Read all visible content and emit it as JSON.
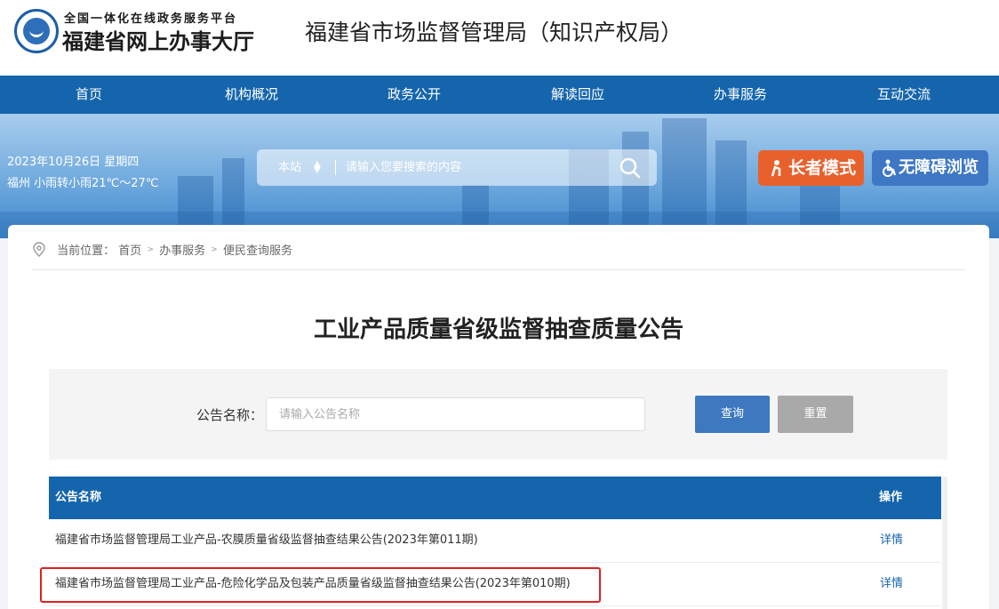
{
  "header": {
    "logo_line1": "全国一体化在线政务服务平台",
    "logo_line2": "福建省网上办事大厅",
    "site_title": "福建省市场监督管理局（知识产权局）"
  },
  "nav": {
    "items": [
      "首页",
      "机构概况",
      "政务公开",
      "解读回应",
      "办事服务",
      "互动交流"
    ]
  },
  "banner": {
    "date": "2023年10月26日 星期四",
    "weather": "福州 小雨转小雨21℃～27℃",
    "search": {
      "scope": "本站",
      "placeholder": "请输入您要搜索的内容"
    },
    "elder_mode": "长者模式",
    "accessibility": "无障碍浏览"
  },
  "breadcrumb": {
    "label": "当前位置：",
    "items": [
      "首页",
      "办事服务",
      "便民查询服务"
    ]
  },
  "page_title": "工业产品质量省级监督抽查质量公告",
  "filter": {
    "label": "公告名称：",
    "placeholder": "请输入公告名称",
    "query_label": "查询",
    "reset_label": "重置"
  },
  "table": {
    "columns": [
      "公告名称",
      "操作"
    ],
    "rows": [
      {
        "name": "福建省市场监督管理局工业产品-农膜质量省级监督抽查结果公告(2023年第011期)",
        "action": "详情",
        "highlighted": false
      },
      {
        "name": "福建省市场监督管理局工业产品-危险化学品及包装产品质量省级监督抽查结果公告(2023年第010期)",
        "action": "详情",
        "highlighted": true
      }
    ]
  },
  "colors": {
    "nav_blue": "#1565ad",
    "elder_orange": "#e8612c",
    "access_blue": "#3e78c5",
    "highlight_red": "#e02020"
  }
}
